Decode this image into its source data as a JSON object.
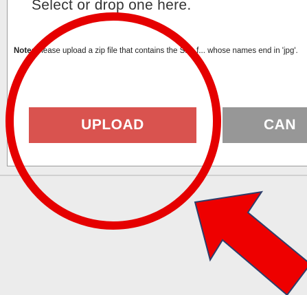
{
  "dialog": {
    "drop_prompt": "Select  or drop one here.",
    "note_label": "Note:",
    "note_text": " Please upload a zip file that contains the SPL f... whose names end in 'jpg'.",
    "upload_label": "UPLOAD",
    "cancel_label": "CAN"
  },
  "annotation": {
    "circle_color": "#e50000",
    "arrow_fill": "#ee0000",
    "arrow_outline": "#2c3e6b"
  }
}
